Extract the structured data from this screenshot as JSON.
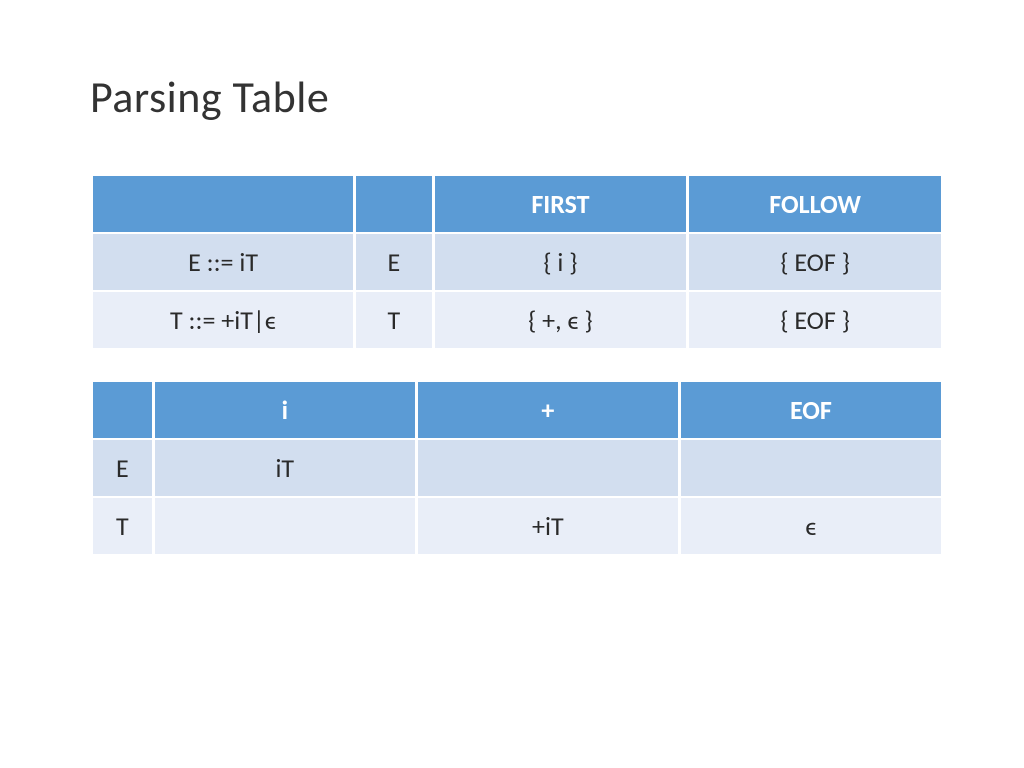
{
  "title": "Parsing Table",
  "table1": {
    "headers": [
      "",
      "",
      "FIRST",
      "FOLLOW"
    ],
    "rows": [
      {
        "grammar": "E ::= iT",
        "nt": "E",
        "first": "{ i }",
        "follow": "{ EOF }"
      },
      {
        "grammar": "T ::= +iT|ϵ",
        "nt": "T",
        "first": "{ +, ϵ }",
        "follow": "{ EOF }"
      }
    ]
  },
  "table2": {
    "headers": [
      "",
      "i",
      "+",
      "EOF"
    ],
    "rows": [
      {
        "nt": "E",
        "i": "iT",
        "plus": "",
        "eof": ""
      },
      {
        "nt": "T",
        "i": "",
        "plus": "+iT",
        "eof": "ϵ"
      }
    ]
  }
}
